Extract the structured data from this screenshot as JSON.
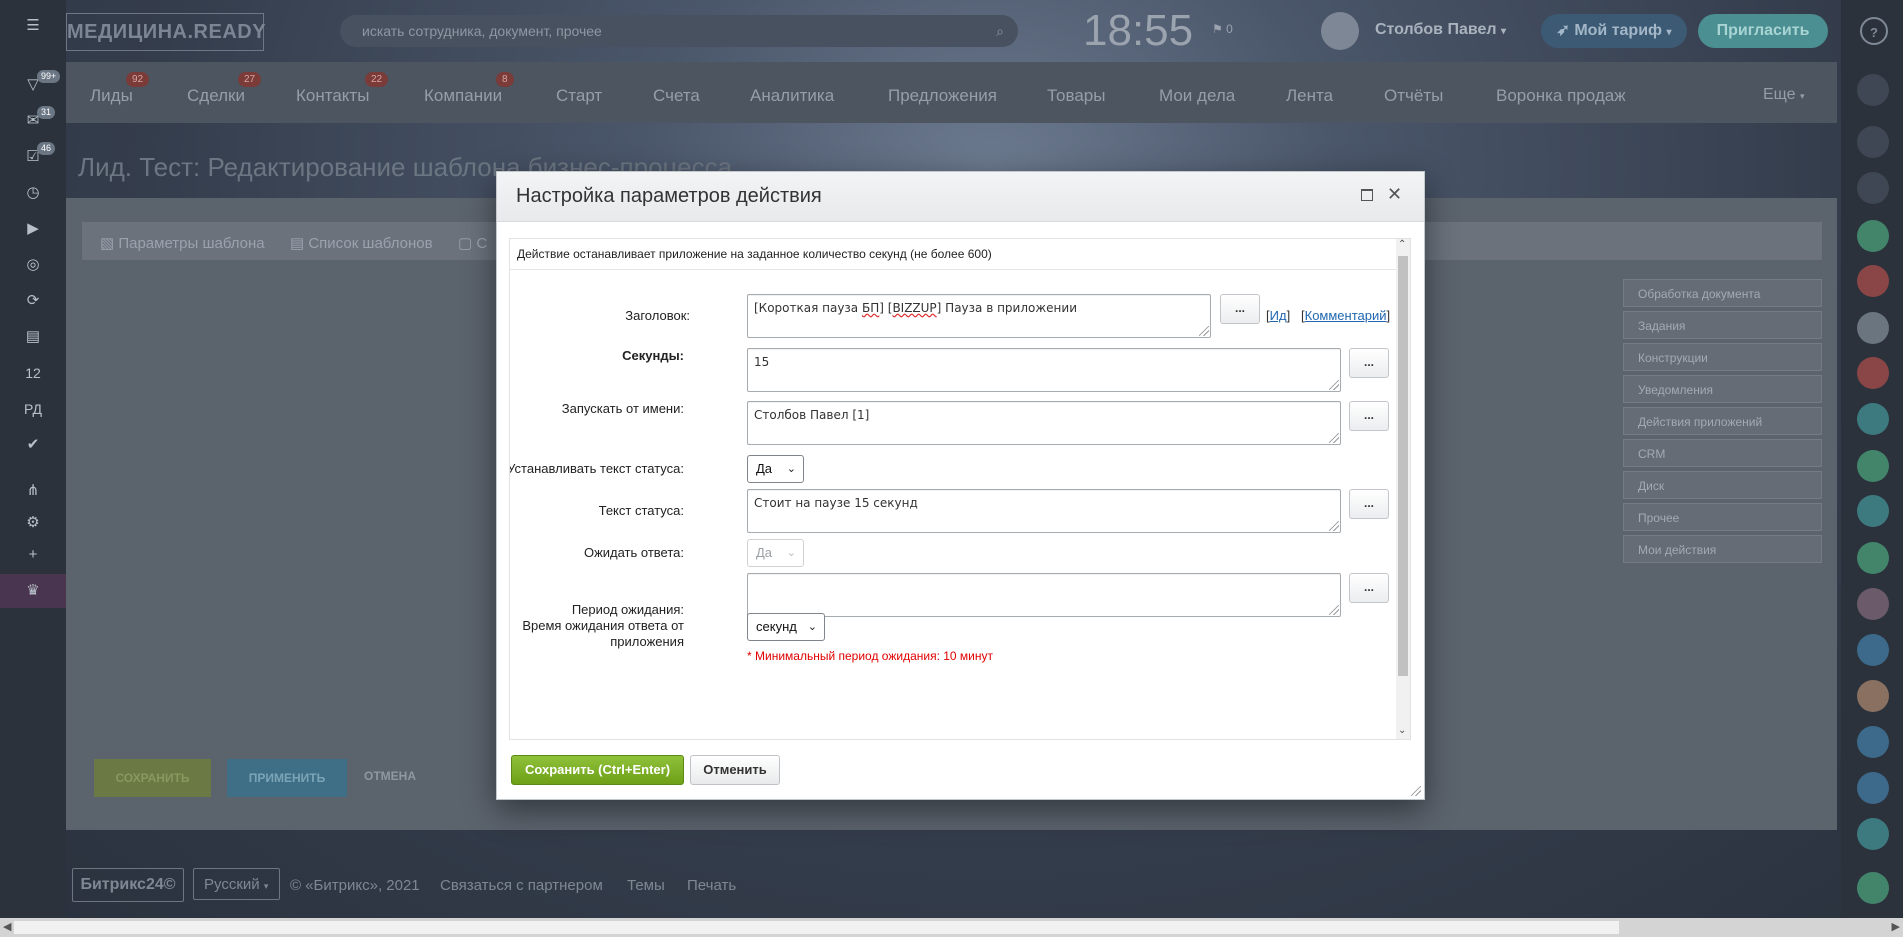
{
  "app": {
    "logo": "МЕДИЦИНА.READY",
    "search_placeholder": "искать сотрудника, документ, прочее",
    "clock": "18:55",
    "flag_count": "0",
    "user_name": "Столбов Павел",
    "tariff_label": "Мой тариф",
    "invite_label": "Пригласить",
    "help": "?"
  },
  "left_bar": {
    "badges": [
      "99+",
      "31",
      "46"
    ],
    "labels": [
      "12",
      "РД"
    ]
  },
  "crm_tabs": [
    {
      "label": "Лиды",
      "badge": "92"
    },
    {
      "label": "Сделки",
      "badge": "27"
    },
    {
      "label": "Контакты",
      "badge": "22"
    },
    {
      "label": "Компании",
      "badge": "8"
    },
    {
      "label": "Старт"
    },
    {
      "label": "Счета"
    },
    {
      "label": "Аналитика"
    },
    {
      "label": "Предложения"
    },
    {
      "label": "Товары"
    },
    {
      "label": "Мои дела"
    },
    {
      "label": "Лента"
    },
    {
      "label": "Отчёты"
    },
    {
      "label": "Воронка продаж"
    },
    {
      "label": "Еще"
    }
  ],
  "page": {
    "title": "Лид. Тест: Редактирование шаблона бизнес-процесса",
    "toolbar": [
      "Параметры шаблона",
      "Список шаблонов",
      "С"
    ],
    "side_list": [
      "Обработка документа",
      "Задания",
      "Конструкции",
      "Уведомления",
      "Действия приложений",
      "CRM",
      "Диск",
      "Прочее",
      "Мои действия"
    ],
    "save_label": "СОХРАНИТЬ",
    "apply_label": "ПРИМЕНИТЬ",
    "cancel_label": "ОТМЕНА"
  },
  "footer": {
    "b24": "Битрикс24©",
    "lang": "Русский",
    "copyright": "© «Битрикс», 2021",
    "partner": "Связаться с партнером",
    "themes": "Темы",
    "print": "Печать"
  },
  "dialog": {
    "title": "Настройка параметров действия",
    "description": "Действие останавливает приложение на заданное количество секунд (не более 600)",
    "fields": {
      "title_label": "Заголовок:",
      "title_value_pre": "[Короткая пауза ",
      "title_value_bp": "БП",
      "title_value_mid": "] [",
      "title_value_bizzup": "BIZZUP",
      "title_value_post": "] Пауза в приложении",
      "id_open": "[",
      "id_link": "Ид",
      "id_close": "]",
      "comment_open": "[",
      "comment_link": "Комментарий",
      "comment_close": "]",
      "seconds_label": "Секунды:",
      "seconds_value": "15",
      "run_as_label": "Запускать от имени:",
      "run_as_value": "Столбов Павел [1]",
      "set_status_label": "Устанавливать текст статуса:",
      "set_status_value": "Да",
      "status_text_label": "Текст статуса:",
      "status_text_value": "Стоит на паузе 15 секунд",
      "wait_reply_label": "Ожидать ответа:",
      "wait_reply_value": "Да",
      "period_label": "Период ожидания:",
      "period_sublabel": "Время ожидания ответа от приложения",
      "period_value": "",
      "period_unit": "секунд",
      "warning": "* Минимальный период ожидания: 10 минут"
    },
    "dots_label": "...",
    "save_button": "Сохранить (Ctrl+Enter)",
    "cancel_button": "Отменить"
  }
}
